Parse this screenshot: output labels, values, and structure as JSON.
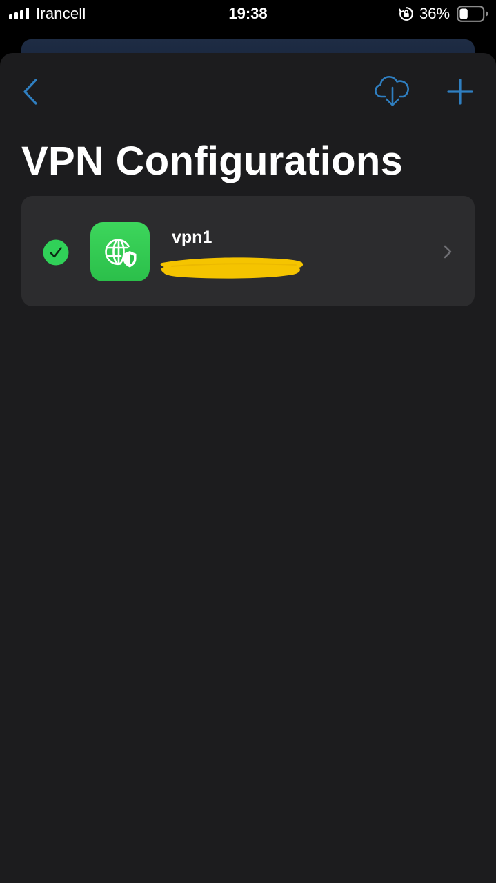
{
  "status_bar": {
    "carrier": "Irancell",
    "time": "19:38",
    "battery_percent": "36%",
    "battery_level": 0.36,
    "signal_bars_filled": 4
  },
  "navigation": {
    "back_icon": "chevron-left-icon",
    "download_icon": "cloud-download-icon",
    "add_icon": "plus-icon",
    "accent_color": "#2f7fc1"
  },
  "page": {
    "title": "VPN Configurations"
  },
  "vpn_list": {
    "items": [
      {
        "name": "vpn1",
        "selected": true,
        "status_icon": "checkmark-circle-icon",
        "app_icon": "globe-shield-icon",
        "detail_redacted": true,
        "disclosure_icon": "chevron-right-icon"
      }
    ]
  },
  "colors": {
    "background": "#000000",
    "sheet": "#1c1c1e",
    "card": "#2c2c2e",
    "check_green": "#30d158",
    "app_icon_green": "#34c759",
    "redaction_yellow": "#f5c400"
  }
}
